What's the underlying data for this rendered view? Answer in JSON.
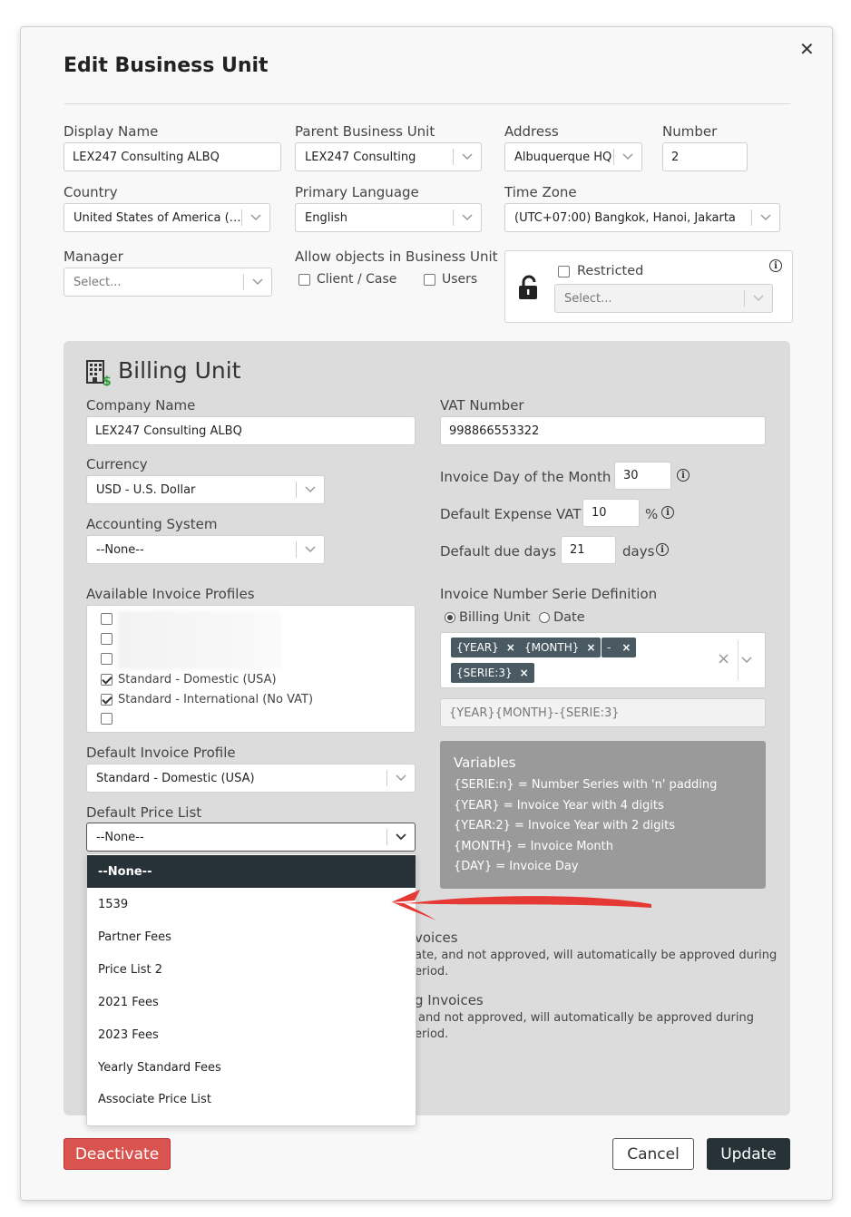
{
  "dialog": {
    "title": "Edit Business Unit",
    "close_glyph": "✕"
  },
  "fields": {
    "display_name": {
      "label": "Display Name",
      "value": "LEX247 Consulting ALBQ"
    },
    "parent_business_unit": {
      "label": "Parent Business Unit",
      "value": "LEX247 Consulting"
    },
    "address": {
      "label": "Address",
      "value": "Albuquerque HQ"
    },
    "number": {
      "label": "Number",
      "value": "2"
    },
    "country": {
      "label": "Country",
      "value": "United States of America (U..."
    },
    "primary_language": {
      "label": "Primary Language",
      "value": "English"
    },
    "time_zone": {
      "label": "Time Zone",
      "value": "(UTC+07:00) Bangkok, Hanoi, Jakarta"
    },
    "manager": {
      "label": "Manager",
      "placeholder": "Select..."
    },
    "allow_objects": {
      "label": "Allow objects in Business Unit",
      "options": [
        {
          "label": "Client / Case",
          "checked": false
        },
        {
          "label": "Users",
          "checked": false
        }
      ]
    },
    "restricted": {
      "label": "Restricted",
      "checked": false,
      "placeholder": "Select..."
    }
  },
  "billing": {
    "title": "Billing Unit",
    "company_name": {
      "label": "Company Name",
      "value": "LEX247 Consulting ALBQ"
    },
    "vat_number": {
      "label": "VAT Number",
      "value": "998866553322"
    },
    "currency": {
      "label": "Currency",
      "value": "USD - U.S. Dollar"
    },
    "accounting_system": {
      "label": "Accounting System",
      "value": "--None--"
    },
    "invoice_day": {
      "label": "Invoice Day of the Month :",
      "value": "30"
    },
    "expense_vat": {
      "label": "Default Expense VAT :",
      "value": "10",
      "unit": "%"
    },
    "due_days": {
      "label": "Default due days :",
      "value": "21",
      "unit": "days"
    },
    "invoice_profiles": {
      "label": "Available Invoice Profiles",
      "items": [
        {
          "label": "",
          "checked": false
        },
        {
          "label": "",
          "checked": false
        },
        {
          "label": "",
          "checked": false
        },
        {
          "label": "Standard - Domestic (USA)",
          "checked": true
        },
        {
          "label": "Standard - International (No VAT)",
          "checked": true
        },
        {
          "label": "",
          "checked": false
        }
      ]
    },
    "serie_definition": {
      "label": "Invoice Number Serie Definition",
      "radio": [
        {
          "label": "Billing Unit",
          "selected": true
        },
        {
          "label": "Date",
          "selected": false
        }
      ],
      "tags": [
        "{YEAR}",
        "{MONTH}",
        "-",
        "{SERIE:3}"
      ],
      "tag_remove_glyph": "×",
      "clear_glyph": "×",
      "preview": "{YEAR}{MONTH}-{SERIE:3}"
    },
    "variables": {
      "heading": "Variables",
      "lines": [
        "{SERIE:n} = Number Series with 'n' padding",
        "{YEAR} = Invoice Year with 4 digits",
        "{YEAR:2} = Invoice Year with 2 digits",
        "{MONTH} = Invoice Month",
        "{DAY} = Invoice Day"
      ]
    },
    "default_invoice_profile": {
      "label": "Default Invoice Profile",
      "value": "Standard - Domestic (USA)"
    },
    "default_price_list": {
      "label": "Default Price List",
      "value": "--None--",
      "options": [
        "--None--",
        "1539",
        "Partner Fees",
        "Price List 2",
        "2021 Fees",
        "2023 Fees",
        "Yearly Standard Fees",
        "Associate Price List"
      ]
    },
    "obscured": {
      "heading1": "voices",
      "line1a": "ate, and not approved, will automatically be approved during",
      "line1b": "eriod.",
      "heading2": "g Invoices",
      "line2a": "and not approved, will automatically be approved during",
      "line2b": "eriod."
    }
  },
  "buttons": {
    "deactivate": "Deactivate",
    "cancel": "Cancel",
    "update": "Update"
  },
  "colors": {
    "deactivate": "#d9534f",
    "primary": "#263238",
    "annotation_arrow": "#e53935"
  }
}
